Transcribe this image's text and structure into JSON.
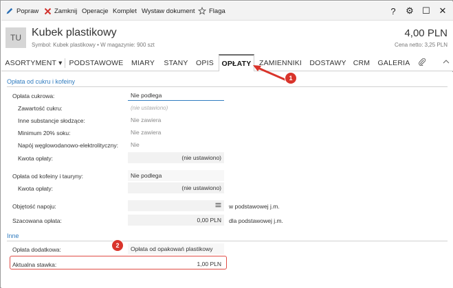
{
  "toolbar": {
    "edit_label": "Popraw",
    "close_label": "Zamknij",
    "operations_label": "Operacje",
    "set_label": "Komplet",
    "issue_doc_label": "Wystaw dokument",
    "flag_label": "Flaga",
    "help_glyph": "?",
    "settings_glyph": "⚙",
    "maximize_glyph": "☐",
    "close_glyph": "✕"
  },
  "header": {
    "avatar_initials": "TU",
    "title": "Kubek plastikowy",
    "subtitle": "Symbol: Kubek plastikowy  •  W magazynie: 900 szt",
    "price": "4,00 PLN",
    "price_net": "Cena netto: 3,25 PLN"
  },
  "tabs": [
    {
      "label": "ASORTYMENT ▾"
    },
    {
      "label": "PODSTAWOWE"
    },
    {
      "label": "MIARY"
    },
    {
      "label": "STANY"
    },
    {
      "label": "OPIS"
    },
    {
      "label": "OPŁATY"
    },
    {
      "label": "ZAMIENNIKI"
    },
    {
      "label": "DOSTAWY"
    },
    {
      "label": "CRM"
    },
    {
      "label": "GALERIA"
    }
  ],
  "section_sugar": {
    "title": "Opłata od cukru i kofeiny",
    "sugar_fee_label": "Opłata cukrowa:",
    "sugar_fee_value": "Nie podlega",
    "sugar_content_label": "Zawartość cukru:",
    "sugar_content_placeholder": "(nie ustawiono)",
    "other_sweeteners_label": "Inne substancje słodzące:",
    "other_sweeteners_value": "Nie zawiera",
    "min_juice_label": "Minimum 20% soku:",
    "min_juice_value": "Nie zawiera",
    "electrolyte_label": "Napój węglowodanowo-elektrolityczny:",
    "electrolyte_value": "Nie",
    "fee_amount_label": "Kwota opłaty:",
    "fee_amount_value": "(nie ustawiono)",
    "caffeine_fee_label": "Opłata od kofeiny i tauryny:",
    "caffeine_fee_value": "Nie podlega",
    "caffeine_amount_label": "Kwota opłaty:",
    "caffeine_amount_value": "(nie ustawiono)",
    "volume_label": "Objętość napoju:",
    "volume_value": "",
    "volume_unit": "w podstawowej j.m.",
    "estimated_fee_label": "Szacowana opłata:",
    "estimated_fee_value": "0,00 PLN",
    "estimated_fee_unit": "dla podstawowej j.m."
  },
  "section_other": {
    "title": "Inne",
    "extra_fee_label": "Opłata dodatkowa:",
    "extra_fee_value": "Opłata od opakowań plastikowy",
    "current_rate_label": "Aktualna stawka:",
    "current_rate_value": "1,00 PLN"
  },
  "annotations": {
    "badge_1": "1",
    "badge_2": "2"
  },
  "colors": {
    "accent": "#2f7bbf",
    "annotation_red": "#d9342b",
    "close_red": "#d0312d",
    "edit_blue": "#2a6fb5"
  }
}
